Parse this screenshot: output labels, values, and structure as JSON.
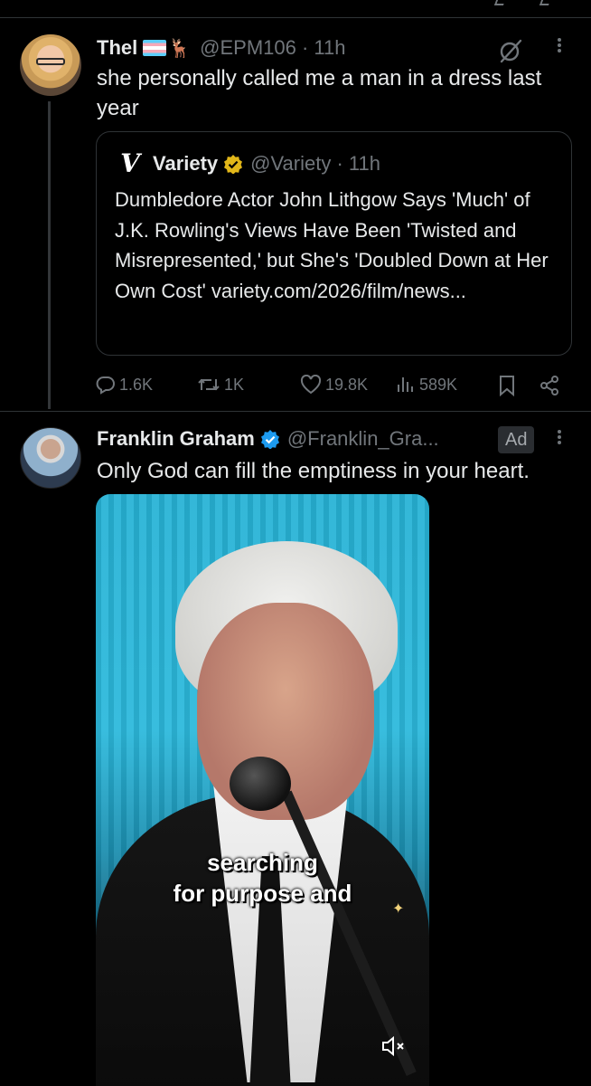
{
  "tweet1": {
    "display_name": "Thel",
    "emoji": "🦌",
    "handle_time": "@EPM106 · 11h",
    "text": "she personally called me a man in a dress last year",
    "quote": {
      "logo": "V",
      "name": "Variety",
      "handle_time": "@Variety · 11h",
      "text": "Dumbledore Actor John Lithgow Says 'Much' of J.K. Rowling's Views Have Been 'Twisted and Misrepresented,' but She's 'Doubled Down at Her Own Cost' variety.com/2026/film/news..."
    },
    "replies": "1.6K",
    "reposts": "1K",
    "likes": "19.8K",
    "views": "589K"
  },
  "tweet2": {
    "display_name": "Franklin Graham",
    "handle": "@Franklin_Gra...",
    "ad_label": "Ad",
    "text": "Only God can fill the emptiness in your heart.",
    "video_caption_line1": "searching",
    "video_caption_line2": "for purpose and"
  },
  "colors": {
    "background": "#000000",
    "text": "#e7e9ea",
    "muted": "#71767b",
    "border": "#2f3336",
    "gold_badge": "#e2b719",
    "blue_badge": "#1d9bf0"
  },
  "icons": [
    "grok-icon",
    "more-icon",
    "reply-icon",
    "repost-icon",
    "like-icon",
    "views-icon",
    "bookmark-icon",
    "share-icon",
    "verified-badge-icon",
    "mute-icon"
  ]
}
